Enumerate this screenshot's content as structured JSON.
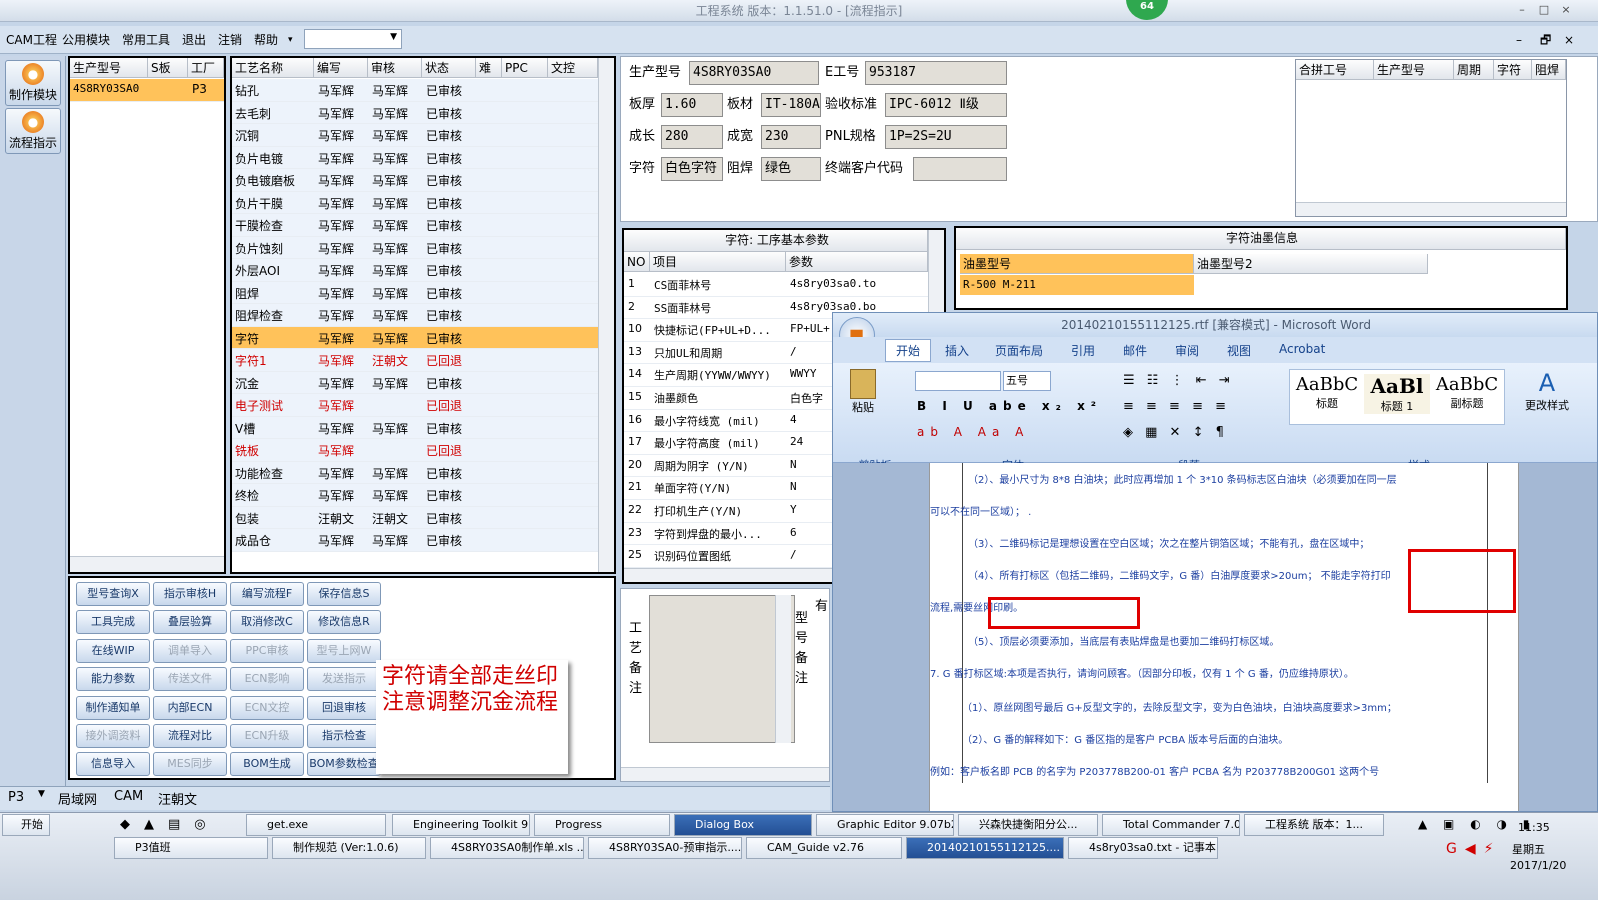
{
  "window": {
    "title": "工程系统  版本：1.1.51.0 - [流程指示]",
    "badge": "64",
    "min": "–",
    "max": "□",
    "close": "×",
    "child_min": "–",
    "child_max": "🗗",
    "child_close": "×"
  },
  "menu": [
    "CAM工程",
    "公用模块",
    "常用工具",
    "退出",
    "注销",
    "帮助",
    "▾"
  ],
  "leftbar": [
    "制作模块",
    "流程指示"
  ],
  "models": {
    "headers": [
      "生产型号",
      "S板",
      "工厂"
    ],
    "row": [
      "4S8RY03SA0",
      "",
      "P3"
    ]
  },
  "process": {
    "headers": [
      "工艺名称",
      "编写",
      "审核",
      "状态",
      "难",
      "PPC",
      "文控"
    ],
    "rows": [
      [
        "钻孔",
        "马军辉",
        "马军辉",
        "已审核"
      ],
      [
        "去毛刺",
        "马军辉",
        "马军辉",
        "已审核"
      ],
      [
        "沉铜",
        "马军辉",
        "马军辉",
        "已审核"
      ],
      [
        "负片电镀",
        "马军辉",
        "马军辉",
        "已审核"
      ],
      [
        "负电镀磨板",
        "马军辉",
        "马军辉",
        "已审核"
      ],
      [
        "负片干膜",
        "马军辉",
        "马军辉",
        "已审核"
      ],
      [
        "干膜检查",
        "马军辉",
        "马军辉",
        "已审核"
      ],
      [
        "负片蚀刻",
        "马军辉",
        "马军辉",
        "已审核"
      ],
      [
        "外层AOI",
        "马军辉",
        "马军辉",
        "已审核"
      ],
      [
        "阻焊",
        "马军辉",
        "马军辉",
        "已审核"
      ],
      [
        "阻焊检查",
        "马军辉",
        "马军辉",
        "已审核"
      ],
      [
        "字符",
        "马军辉",
        "马军辉",
        "已审核"
      ],
      [
        "字符1",
        "马军辉",
        "汪朝文",
        "已回退"
      ],
      [
        "沉金",
        "马军辉",
        "马军辉",
        "已审核"
      ],
      [
        "电子测试",
        "马军辉",
        "",
        "已回退"
      ],
      [
        "V槽",
        "马军辉",
        "马军辉",
        "已审核"
      ],
      [
        "铣板",
        "马军辉",
        "",
        "已回退"
      ],
      [
        "功能检查",
        "马军辉",
        "马军辉",
        "已审核"
      ],
      [
        "终检",
        "马军辉",
        "马军辉",
        "已审核"
      ],
      [
        "包装",
        "汪朝文",
        "汪朝文",
        "已审核"
      ],
      [
        "成品仓",
        "马军辉",
        "马军辉",
        "已审核"
      ]
    ]
  },
  "info": {
    "labels": [
      "生产型号",
      "E工号",
      "板厚",
      "板材",
      "验收标准",
      "成长",
      "成宽",
      "PNL规格",
      "字符",
      "阻焊",
      "终端客户代码"
    ],
    "values": [
      "4S8RY03SA0",
      "953187",
      "1.60",
      "IT-180A",
      "IPC-6012 Ⅱ级",
      "280",
      "230",
      "1P=2S=2U",
      "白色字符",
      "绿色",
      ""
    ]
  },
  "merge": {
    "headers": [
      "合拼工号",
      "生产型号",
      "周期",
      "字符",
      "阻焊"
    ]
  },
  "params": {
    "title": "字符: 工序基本参数",
    "headers": [
      "NO",
      "项目",
      "参数"
    ],
    "rows": [
      [
        "1",
        "CS面菲林号",
        "4s8ry03sa0.to"
      ],
      [
        "2",
        "SS面菲林号",
        "4s8ry03sa0.bo"
      ],
      [
        "10",
        "快捷标记(FP+UL+D...",
        "FP+UL+"
      ],
      [
        "13",
        "只加UL和周期",
        "/"
      ],
      [
        "14",
        "生产周期(YYWW/WWYY)",
        "WWYY"
      ],
      [
        "15",
        "油墨颜色",
        "白色字"
      ],
      [
        "16",
        "最小字符线宽 (mil)",
        "4"
      ],
      [
        "17",
        "最小字符高度 (mil)",
        "24"
      ],
      [
        "20",
        "周期为阴字 (Y/N)",
        "N"
      ],
      [
        "21",
        "单面字符(Y/N)",
        "N"
      ],
      [
        "22",
        "打印机生产(Y/N)",
        "Y"
      ],
      [
        "23",
        "字符到焊盘的最小...",
        "6"
      ],
      [
        "25",
        "识别码位置图纸",
        "/"
      ]
    ]
  },
  "ink": {
    "title": "字符油墨信息",
    "headers": [
      "油墨型号",
      "油墨型号2"
    ],
    "row": [
      "R-500 M-211",
      ""
    ]
  },
  "buttons": [
    [
      "型号查询X",
      "指示审核H",
      "编写流程F",
      "保存信息S"
    ],
    [
      "工具完成",
      "叠层验算",
      "取消修改C",
      "修改信息R"
    ],
    [
      "在线WIP",
      "调单导入",
      "PPC审核",
      "型号上网W"
    ],
    [
      "能力参数",
      "传送文件",
      "ECN影响",
      "发送指示"
    ],
    [
      "制作通知单",
      "内部ECN",
      "ECN文控",
      "回退审核"
    ],
    [
      "接外调资料",
      "流程对比",
      "ECN升级",
      "指示检查"
    ],
    [
      "信息导入",
      "MES同步",
      "BOM生成",
      "BOM参数检查"
    ]
  ],
  "disabled": [
    [
      2,
      1
    ],
    [
      2,
      2
    ],
    [
      2,
      3
    ],
    [
      3,
      1
    ],
    [
      3,
      2
    ],
    [
      3,
      3
    ],
    [
      4,
      2
    ],
    [
      5,
      0
    ],
    [
      5,
      2
    ],
    [
      6,
      1
    ]
  ],
  "note": "字符请全部走丝印  注意调整沉金流程",
  "remarks": {
    "left": "工艺备注",
    "right": "型号备注",
    "right_top": "有"
  },
  "status": {
    "p3": "P3",
    "tabs": [
      "局域网",
      "CAM",
      "汪朝文"
    ]
  },
  "word": {
    "title": "20140210155112125.rtf [兼容模式] - Microsoft Word",
    "tabs": [
      "开始",
      "插入",
      "页面布局",
      "引用",
      "邮件",
      "审阅",
      "视图",
      "Acrobat"
    ],
    "groups": [
      "剪贴板",
      "字体",
      "段落",
      "样式"
    ],
    "paste": "粘贴",
    "font_size": "五号",
    "styles": [
      [
        "AaBbC",
        "标题"
      ],
      [
        "AaBl",
        "标题 1"
      ],
      [
        "AaBbC",
        "副标题"
      ]
    ],
    "change_styles": "更改样式",
    "lines": [
      "（2）、最小尺寸为 8*8 白油块；此时应再增加 1 个 3*10 条码标志区白油块（必须要加在同一层",
      "可以不在同一区域）；  .",
      "（3）、二维码标记是理想设置在空白区域；次之在整片铜箔区域；不能有孔，盘在区域中；",
      "（4）、所有打标区（包括二维码，二维码文字，G 番）白油厚度要求>20um；  不能走字符打印",
      "流程,需要丝网印刷。",
      "（5）、顶层必须要添加，当底层有表贴焊盘是也要加二维码打标区域。",
      "7. G 番打标区域:本项是否执行，请询问顾客。（因部分印板，仅有 1 个 G 番，仍应维持原状）。",
      "（1）、原丝网图号最后 G+反型文字的，去除反型文字，变为白色油块，白油块高度要求>3mm；",
      "（2）、G 番的解释如下：G 番区指的是客户 PCBA 版本号后面的白油块。",
      "例如：客户板名即 PCB 的名字为 P203778B200-01   客户  PCBA  名为 P203778B200G01  这两个号"
    ]
  },
  "taskbar": {
    "start": "开始",
    "row1": [
      "get.exe",
      "Engineering Toolkit 9....",
      "Progress",
      "Dialog Box",
      "Graphic Editor 9.07b2...",
      "兴森快捷衡阳分公...",
      "Total Commander 7.0...",
      "工程系统  版本：1..."
    ],
    "row2": [
      "P3值班",
      "制作规范 (Ver:1.0.6)",
      "4S8RY03SA0制作单.xls ...",
      "4S8RY03SA0-预审指示....",
      "CAM_Guide v2.76",
      "20140210155112125....",
      "4s8ry03sa0.txt - 记事本"
    ],
    "time": "11:35",
    "weekday": "星期五",
    "date": "2017/1/20"
  },
  "colors": {
    "selected": "#ffc25a",
    "rejected": "#d00000",
    "highlight_box": "#e00000"
  }
}
